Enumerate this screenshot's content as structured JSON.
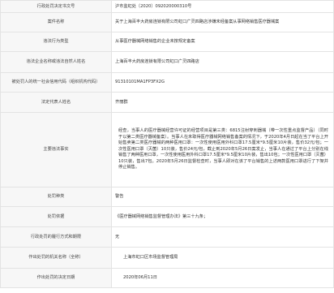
{
  "rows": [
    {
      "label": "行政处罚决定书文号",
      "value": "沪市监虹处〔2020〕092020000310号"
    },
    {
      "label": "案件名称",
      "value": "关于上海百丰大药房连锁有限公司虹口广灵四路店涉嫌未经备案从事网络销售医疗器械案"
    },
    {
      "label": "违法行为类型",
      "value": "从事医疗器械网络销售的企业未按规定备案"
    },
    {
      "label": "违法企业名称或违法自然人姓名",
      "value": "上海百丰大药房连锁有限公司虹口广灵四路店"
    },
    {
      "label": "被处罚人的统一社会信用代码（组织机构代码）",
      "value": "91310101MA1FP3FX2G"
    },
    {
      "label": "法定代表人姓名",
      "value": "齐丽群"
    },
    {
      "label": "主要违法事实",
      "value": "经查，当事人的医疗器械经营许可证的经营项目是第三类：6815注射穿刺器械（带一次性重点监督产品）（同时于以第二类医疗器械备案）。当事人在未取得医疗器械网络销售备案的情况下，于2020年4月日起在当了平台上开始售卖第二类医疗器械的两种医用口罩：一次性使用医用外科口罩17.5厘米*9.5厘米10片装，售价32元/包；一次性医用口罩（灭菌）10只装，售价24元/包，截止到2020年5月26日案发止，当事人在通过了平台上分别在线销售了两种医用口罩，一次性使用医用外科口罩17.5厘米*9.5厘米10片装，售出10包；一次性医用口罩（灭菌）10只装，售出7包。2020年5月26日监督检查时，当事人即对在该了平台销售的上述两款医用口罩进行了下架并停止销售。"
    },
    {
      "label": "处罚种类",
      "value": "警告"
    },
    {
      "label": "处罚依据",
      "value": "《医疗器械网络销售监督管理办法》第三十九条；"
    },
    {
      "label": "行政处罚的履行方式和期限",
      "value": "无"
    },
    {
      "label": "作出处罚的机关名称（全称）",
      "value": "上海市虹口区市场监督管理局"
    },
    {
      "label": "作出处罚的决定日期",
      "value": "2020年06月11日"
    }
  ]
}
